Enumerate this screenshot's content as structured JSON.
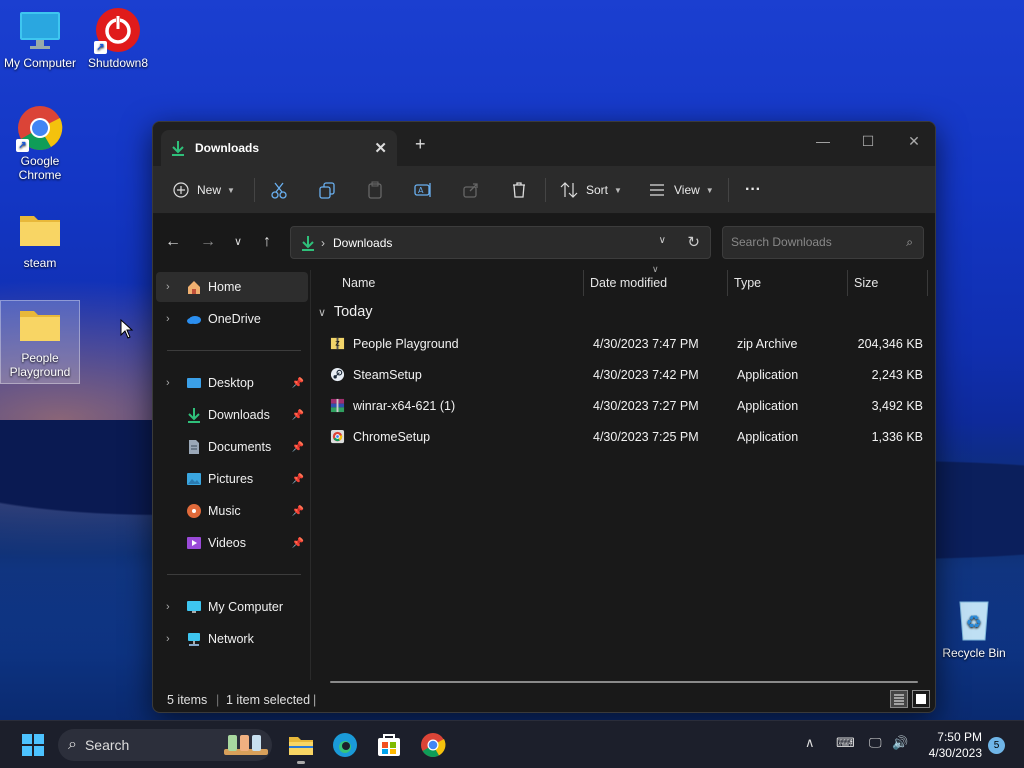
{
  "desktop": {
    "icons": [
      {
        "label": "My Computer",
        "icon": "monitor-icon"
      },
      {
        "label": "Shutdown8",
        "icon": "power-icon"
      },
      {
        "label": "Google Chrome",
        "icon": "chrome-icon"
      },
      {
        "label": "steam",
        "icon": "folder-icon"
      },
      {
        "label": "People Playground",
        "icon": "folder-icon"
      },
      {
        "label": "Recycle Bin",
        "icon": "recycle-bin-icon"
      }
    ]
  },
  "window": {
    "tab_title": "Downloads",
    "toolbar": {
      "new_label": "New",
      "sort_label": "Sort",
      "view_label": "View",
      "more_label": "···"
    },
    "address": {
      "location": "Downloads",
      "search_placeholder": "Search Downloads"
    },
    "sidebar": {
      "items": [
        {
          "label": "Home",
          "icon": "home-icon",
          "expandable": true
        },
        {
          "label": "OneDrive",
          "icon": "cloud-icon",
          "expandable": true
        },
        {
          "label": "Desktop",
          "icon": "desktop-icon",
          "expandable": true,
          "pinned": true
        },
        {
          "label": "Downloads",
          "icon": "download-icon",
          "expandable": false,
          "pinned": true
        },
        {
          "label": "Documents",
          "icon": "document-icon",
          "expandable": false,
          "pinned": true
        },
        {
          "label": "Pictures",
          "icon": "picture-icon",
          "expandable": false,
          "pinned": true
        },
        {
          "label": "Music",
          "icon": "music-icon",
          "expandable": false,
          "pinned": true
        },
        {
          "label": "Videos",
          "icon": "video-icon",
          "expandable": false,
          "pinned": true
        },
        {
          "label": "My Computer",
          "icon": "monitor-icon",
          "expandable": true
        },
        {
          "label": "Network",
          "icon": "network-icon",
          "expandable": true
        }
      ]
    },
    "columns": {
      "name": "Name",
      "date": "Date modified",
      "type": "Type",
      "size": "Size"
    },
    "group_label": "Today",
    "files": [
      {
        "name": "People Playground",
        "date": "4/30/2023 7:47 PM",
        "type": "zip Archive",
        "size": "204,346 KB",
        "icon": "zip-icon"
      },
      {
        "name": "SteamSetup",
        "date": "4/30/2023 7:42 PM",
        "type": "Application",
        "size": "2,243 KB",
        "icon": "steam-icon"
      },
      {
        "name": "winrar-x64-621 (1)",
        "date": "4/30/2023 7:27 PM",
        "type": "Application",
        "size": "3,492 KB",
        "icon": "winrar-icon"
      },
      {
        "name": "ChromeSetup",
        "date": "4/30/2023 7:25 PM",
        "type": "Application",
        "size": "1,336 KB",
        "icon": "chrome-icon"
      }
    ],
    "status": {
      "items": "5 items",
      "selected": "1 item selected"
    }
  },
  "taskbar": {
    "search_label": "Search",
    "time": "7:50 PM",
    "date": "4/30/2023",
    "notification_count": "5"
  }
}
